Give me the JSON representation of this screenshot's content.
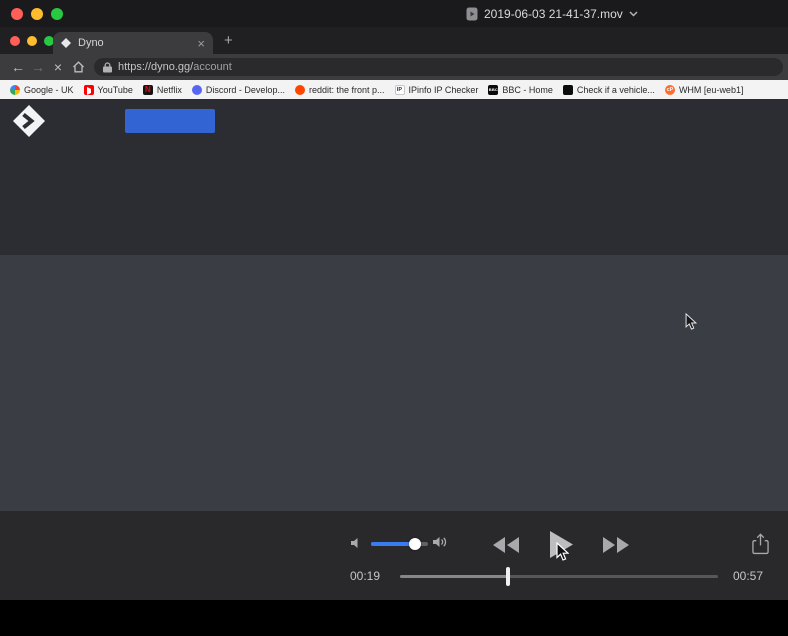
{
  "window": {
    "title": "2019-06-03 21-41-37.mov"
  },
  "browser": {
    "tab_label": "Dyno",
    "tab_close": "×",
    "new_tab": "+",
    "nav_back": "←",
    "nav_forward": "→",
    "nav_stop": "×",
    "url_host": "https://dyno.gg/",
    "url_path": "account",
    "bookmarks": [
      {
        "label": "Google - UK",
        "icon": "google-favicon"
      },
      {
        "label": "YouTube",
        "icon": "youtube-favicon"
      },
      {
        "label": "Netflix",
        "icon": "netflix-favicon"
      },
      {
        "label": "Discord - Develop...",
        "icon": "discord-favicon"
      },
      {
        "label": "reddit: the front p...",
        "icon": "reddit-favicon"
      },
      {
        "label": "IPinfo IP Checker",
        "icon": "ipinfo-favicon"
      },
      {
        "label": "BBC - Home",
        "icon": "bbc-favicon"
      },
      {
        "label": "Check if a vehicle...",
        "icon": "gov-favicon"
      },
      {
        "label": "WHM [eu-web1]",
        "icon": "whm-favicon"
      }
    ]
  },
  "player": {
    "elapsed": "00:19",
    "duration": "00:57",
    "progress_percent": 34,
    "volume_percent": 77,
    "icons": {
      "volume_low": "speaker",
      "volume_high": "speaker-waves",
      "rewind": "double-triangle-left",
      "play": "triangle-right",
      "fast_forward": "double-triangle-right",
      "share": "box-with-up-arrow"
    }
  },
  "colors": {
    "accent_blue": "#3265d3",
    "volume_blue": "#3a7bf3",
    "traffic_red": "#ff5f57",
    "traffic_yellow": "#febc2e",
    "traffic_green": "#28c840"
  }
}
